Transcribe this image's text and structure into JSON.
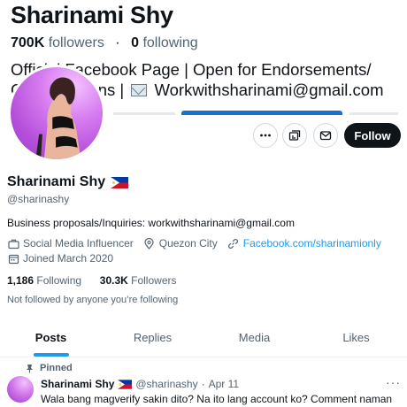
{
  "banner": {
    "name": "Sharinami Shy",
    "followers_count": "700K",
    "followers_label": "followers",
    "separator": "·",
    "following_count": "0",
    "following_label": "following",
    "line1": "Official Facebook Page | Open for Endorsements/",
    "line2_start": "Collaborations |",
    "line2_email": "Workwithsharinami@gmail.com"
  },
  "actions": {
    "follow_label": "Follow",
    "more_icon": "more-icon",
    "subscribe_icon": "subscribe-icon",
    "message_icon": "message-icon"
  },
  "profile": {
    "name": "Sharinami Shy",
    "flag": "philippines-flag-icon",
    "handle": "@sharinashy",
    "bio": "Business proposals/Inquiries: workwithsharinami@gmail.com",
    "category": "Social Media Influencer",
    "location": "Quezon City",
    "link": "Facebook.com/sharinamionly",
    "joined": "Joined March 2020",
    "following_count": "1,186",
    "following_label": "Following",
    "followers_count": "30.3K",
    "followers_label": "Followers",
    "not_followed": "Not followed by anyone you’re following"
  },
  "tabs": [
    {
      "label": "Posts",
      "active": true
    },
    {
      "label": "Replies",
      "active": false
    },
    {
      "label": "Media",
      "active": false
    },
    {
      "label": "Likes",
      "active": false
    }
  ],
  "pinned_tweet": {
    "pinned_label": "Pinned",
    "name": "Sharinami Shy",
    "handle": "@sharinashy",
    "dot": "·",
    "date": "Apr 11",
    "more": "···",
    "text": "Wala bang magverify sakin dito? Na ito lang account ko? Comment naman"
  },
  "colors": {
    "accent": "#1d9bf0",
    "text": "#0f1419",
    "secondary": "#536471",
    "follow_button": "#0f1419"
  }
}
